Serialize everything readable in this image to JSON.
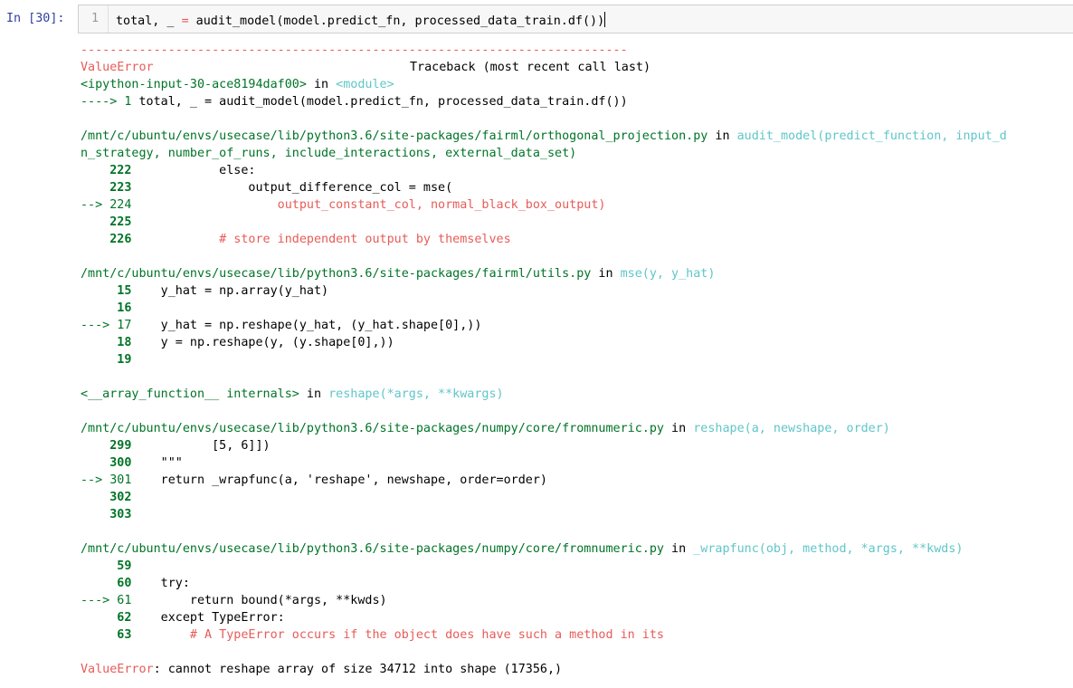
{
  "cell": {
    "prompt": "In [30]:",
    "line_number": "1",
    "code_pre": "total, _ ",
    "code_eq": "=",
    "code_mid": " audit_model(model.predict_fn, processed_data_train.df()",
    "code_end": ")"
  },
  "traceback": {
    "separator": "---------------------------------------------------------------------------",
    "error_name": "ValueError",
    "header_right": "Traceback (most recent call last)",
    "frame0": {
      "location": "<ipython-input-30-ace8194daf00>",
      "in_word": "in",
      "func": "<module>",
      "arrow": "----> 1 ",
      "code": "total, _ = audit_model(model.predict_fn, processed_data_train.df())"
    },
    "frame1": {
      "path": "/mnt/c/ubuntu/envs/usecase/lib/python3.6/site-packages/fairml/orthogonal_projection.py",
      "in_word": "in",
      "func": "audit_model(predict_function, input_d",
      "func_cont": "n_strategy, number_of_runs, include_interactions, external_data_set)",
      "lines": [
        {
          "num": "    222",
          "code": "            else:",
          "arrow": false,
          "red": false
        },
        {
          "num": "    223",
          "code": "                output_difference_col = mse(",
          "arrow": false,
          "red": false
        },
        {
          "num": "--> 224",
          "code": "                    output_constant_col, normal_black_box_output)",
          "arrow": true,
          "red": true
        },
        {
          "num": "    225",
          "code": "",
          "arrow": false,
          "red": false
        },
        {
          "num": "    226",
          "code": "            # store independent output by themselves",
          "arrow": false,
          "red": true
        }
      ]
    },
    "frame2": {
      "path": "/mnt/c/ubuntu/envs/usecase/lib/python3.6/site-packages/fairml/utils.py",
      "in_word": "in",
      "func": "mse(y, y_hat)",
      "lines": [
        {
          "num": "     15",
          "code": "    y_hat = np.array(y_hat)"
        },
        {
          "num": "     16",
          "code": ""
        },
        {
          "num": "---> 17",
          "code": "    y_hat = np.reshape(y_hat, (y_hat.shape[0],))"
        },
        {
          "num": "     18",
          "code": "    y = np.reshape(y, (y.shape[0],))"
        },
        {
          "num": "     19",
          "code": ""
        }
      ]
    },
    "frame3": {
      "location": "<__array_function__ internals>",
      "in_word": "in",
      "func": "reshape(*args, **kwargs)"
    },
    "frame4": {
      "path": "/mnt/c/ubuntu/envs/usecase/lib/python3.6/site-packages/numpy/core/fromnumeric.py",
      "in_word": "in",
      "func": "reshape(a, newshape, order)",
      "lines": [
        {
          "num": "    299",
          "code": "           [5, 6]])"
        },
        {
          "num": "    300",
          "code": "    \"\"\""
        },
        {
          "num": "--> 301",
          "code": "    return _wrapfunc(a, 'reshape', newshape, order=order)"
        },
        {
          "num": "    302",
          "code": ""
        },
        {
          "num": "    303",
          "code": ""
        }
      ]
    },
    "frame5": {
      "path": "/mnt/c/ubuntu/envs/usecase/lib/python3.6/site-packages/numpy/core/fromnumeric.py",
      "in_word": "in",
      "func": "_wrapfunc(obj, method, *args, **kwds)",
      "lines": [
        {
          "num": "     59",
          "code": ""
        },
        {
          "num": "     60",
          "code": "    try:"
        },
        {
          "num": "---> 61",
          "code": "        return bound(*args, **kwds)"
        },
        {
          "num": "     62",
          "code": "    except TypeError:"
        },
        {
          "num": "     63",
          "code": "        # A TypeError occurs if the object does have such a method in its"
        }
      ]
    },
    "final_error_name": "ValueError",
    "final_error_message": ": cannot reshape array of size 34712 into shape (17356,)"
  },
  "colors": {
    "prompt": "#303f9f",
    "error_red": "#e75c58",
    "path_green": "#00a250",
    "func_cyan": "#60c6c8",
    "input_bg": "#f7f7f7"
  }
}
